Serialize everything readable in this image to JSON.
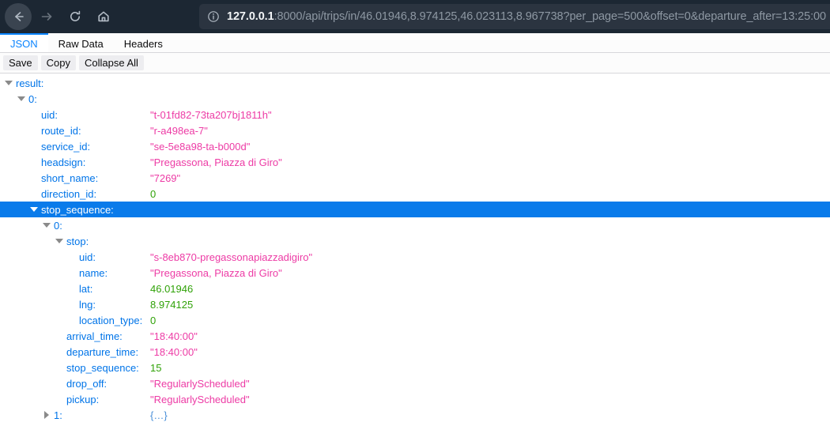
{
  "browser": {
    "nav": {
      "back_icon": "back-arrow-icon",
      "forward_icon": "forward-arrow-icon",
      "reload_icon": "reload-icon",
      "home_icon": "home-icon"
    },
    "urlbar": {
      "info_icon": "info-circle-icon",
      "host": "127.0.0.1",
      "path": ":8000/api/trips/in/46.01946,8.974125,46.023113,8.967738?per_page=500&offset=0&departure_after=13:25:00",
      "full_url": "127.0.0.1:8000/api/trips/in/46.01946,8.974125,46.023113,8.967738?per_page=500&offset=0&departure_after=13:25:00"
    }
  },
  "viewer": {
    "tabs": [
      {
        "label": "JSON",
        "active": true
      },
      {
        "label": "Raw Data",
        "active": false
      },
      {
        "label": "Headers",
        "active": false
      }
    ],
    "toolbar": [
      {
        "label": "Save"
      },
      {
        "label": "Copy"
      },
      {
        "label": "Collapse All"
      }
    ],
    "accent_color": "#0a84ff",
    "selection_color": "#0a7bea"
  },
  "json_rows": [
    {
      "indent": 0,
      "twisty": "open",
      "key": "result:",
      "value": "",
      "type": "none",
      "selected": false
    },
    {
      "indent": 1,
      "twisty": "open",
      "key": "0:",
      "value": "",
      "type": "none",
      "selected": false
    },
    {
      "indent": 2,
      "twisty": "none",
      "key": "uid:",
      "value": "\"t-01fd82-73ta207bj1811h\"",
      "type": "string",
      "selected": false
    },
    {
      "indent": 2,
      "twisty": "none",
      "key": "route_id:",
      "value": "\"r-a498ea-7\"",
      "type": "string",
      "selected": false
    },
    {
      "indent": 2,
      "twisty": "none",
      "key": "service_id:",
      "value": "\"se-5e8a98-ta-b000d\"",
      "type": "string",
      "selected": false
    },
    {
      "indent": 2,
      "twisty": "none",
      "key": "headsign:",
      "value": "\"Pregassona, Piazza di Giro\"",
      "type": "string",
      "selected": false
    },
    {
      "indent": 2,
      "twisty": "none",
      "key": "short_name:",
      "value": "\"7269\"",
      "type": "string",
      "selected": false
    },
    {
      "indent": 2,
      "twisty": "none",
      "key": "direction_id:",
      "value": "0",
      "type": "number",
      "selected": false
    },
    {
      "indent": 2,
      "twisty": "open",
      "key": "stop_sequence:",
      "value": "",
      "type": "none",
      "selected": true
    },
    {
      "indent": 3,
      "twisty": "open",
      "key": "0:",
      "value": "",
      "type": "none",
      "selected": false
    },
    {
      "indent": 4,
      "twisty": "open",
      "key": "stop:",
      "value": "",
      "type": "none",
      "selected": false
    },
    {
      "indent": 5,
      "twisty": "none",
      "key": "uid:",
      "value": "\"s-8eb870-pregassonapiazzadigiro\"",
      "type": "string",
      "selected": false
    },
    {
      "indent": 5,
      "twisty": "none",
      "key": "name:",
      "value": "\"Pregassona, Piazza di Giro\"",
      "type": "string",
      "selected": false
    },
    {
      "indent": 5,
      "twisty": "none",
      "key": "lat:",
      "value": "46.01946",
      "type": "number",
      "selected": false
    },
    {
      "indent": 5,
      "twisty": "none",
      "key": "lng:",
      "value": "8.974125",
      "type": "number",
      "selected": false
    },
    {
      "indent": 5,
      "twisty": "none",
      "key": "location_type:",
      "value": "0",
      "type": "number",
      "selected": false
    },
    {
      "indent": 4,
      "twisty": "none",
      "key": "arrival_time:",
      "value": "\"18:40:00\"",
      "type": "string",
      "selected": false
    },
    {
      "indent": 4,
      "twisty": "none",
      "key": "departure_time:",
      "value": "\"18:40:00\"",
      "type": "string",
      "selected": false
    },
    {
      "indent": 4,
      "twisty": "none",
      "key": "stop_sequence:",
      "value": "15",
      "type": "number",
      "selected": false
    },
    {
      "indent": 4,
      "twisty": "none",
      "key": "drop_off:",
      "value": "\"RegularlyScheduled\"",
      "type": "string",
      "selected": false
    },
    {
      "indent": 4,
      "twisty": "none",
      "key": "pickup:",
      "value": "\"RegularlyScheduled\"",
      "type": "string",
      "selected": false
    },
    {
      "indent": 3,
      "twisty": "closed",
      "key": "1:",
      "value": "{…}",
      "type": "object",
      "selected": false
    }
  ]
}
